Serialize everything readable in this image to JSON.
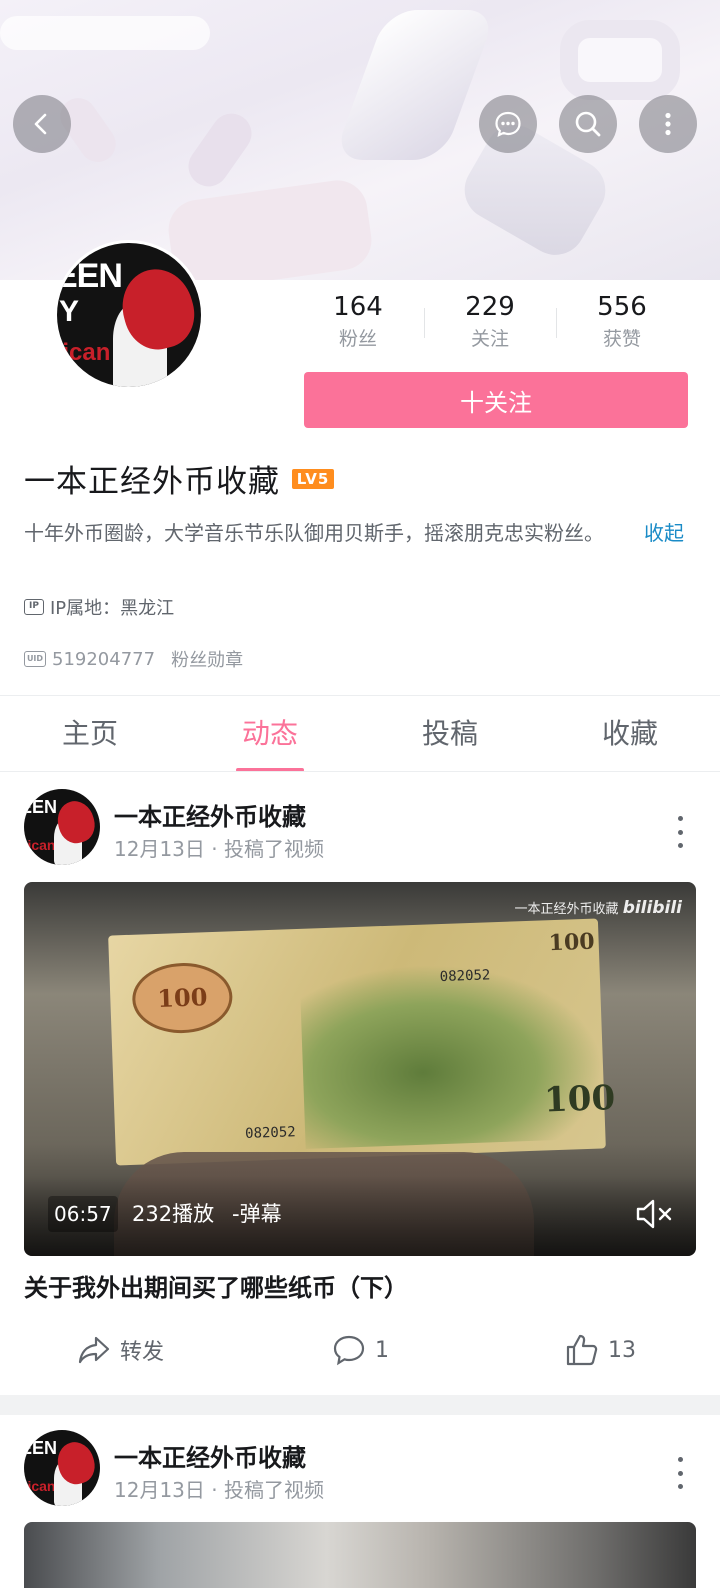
{
  "header": {
    "back_icon": "chevron-left-icon",
    "message_icon": "chat-bubble-icon",
    "search_icon": "search-icon",
    "more_icon": "more-vertical-icon"
  },
  "profile": {
    "stats": [
      {
        "num": "164",
        "label": "粉丝"
      },
      {
        "num": "229",
        "label": "关注"
      },
      {
        "num": "556",
        "label": "获赞"
      }
    ],
    "follow_label": "十关注",
    "name": "一本正经外币收藏",
    "level": "LV5",
    "bio": "十年外币圈龄，大学音乐节乐队御用贝斯手，摇滚朋克忠实粉丝。",
    "collapse_label": "收起",
    "ip_badge": "IP",
    "ip_text": "IP属地：黑龙江",
    "uid_badge": "UID",
    "uid": "519204777",
    "medal": "粉丝勋章"
  },
  "tabs": [
    "主页",
    "动态",
    "投稿",
    "收藏"
  ],
  "active_tab": "动态",
  "posts": [
    {
      "author": "一本正经外币收藏",
      "sub": "12月13日 · 投稿了视频",
      "watermark_text": "一本正经外币收藏",
      "watermark_brand": "bilibili",
      "duration": "06:57",
      "plays": "232播放",
      "danmaku": "-弹幕",
      "title": "关于我外出期间买了哪些纸币（下）",
      "share_label": "转发",
      "comments": "1",
      "likes": "13"
    },
    {
      "author": "一本正经外币收藏",
      "sub": "12月13日 · 投稿了视频"
    }
  ],
  "colors": {
    "accent": "#fb7299",
    "link": "#1a8bc7",
    "level_badge": "#ff8d1e"
  }
}
